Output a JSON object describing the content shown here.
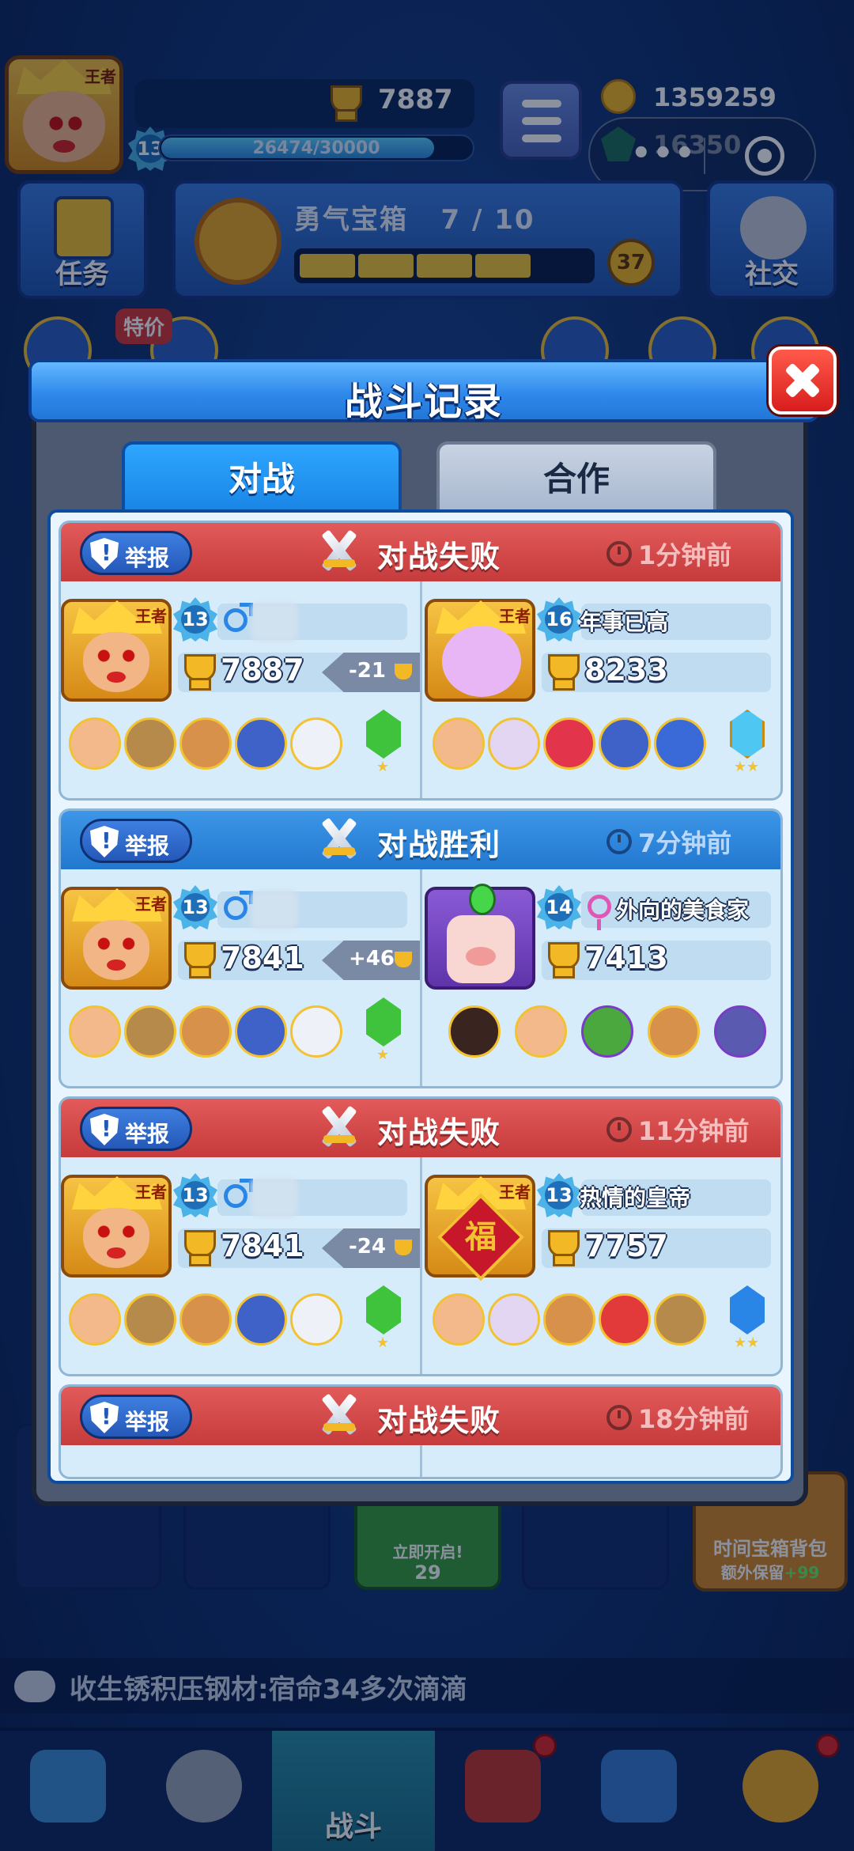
{
  "player": {
    "king_badge": "王者",
    "level": "13",
    "xp_text": "26474/30000",
    "xp_progress": 0.88,
    "trophies": "7887"
  },
  "currency": {
    "coins": "1359259",
    "gems": "16350"
  },
  "menu": {
    "tasks": "任务",
    "social": "社交"
  },
  "chest": {
    "title": "勇气宝箱",
    "progress": "7 / 10",
    "badge": "37"
  },
  "promo": {
    "sale": "特价"
  },
  "modal": {
    "title": "战斗记录",
    "tabs": [
      {
        "label": "对战"
      },
      {
        "label": "合作"
      }
    ]
  },
  "battles": [
    {
      "report": "举报",
      "result": "对战失败",
      "time": "1分钟前",
      "left": {
        "level": "13",
        "trophies": "7887",
        "delta": "-21"
      },
      "right": {
        "level": "16",
        "name": "年事已高",
        "trophies": "8233"
      }
    },
    {
      "report": "举报",
      "result": "对战胜利",
      "time": "7分钟前",
      "left": {
        "level": "13",
        "trophies": "7841",
        "delta": "+46"
      },
      "right": {
        "level": "14",
        "name": "外向的美食家",
        "trophies": "7413"
      }
    },
    {
      "report": "举报",
      "result": "对战失败",
      "time": "11分钟前",
      "left": {
        "level": "13",
        "trophies": "7841",
        "delta": "-24"
      },
      "right": {
        "level": "13",
        "name": "热情的皇帝",
        "trophies": "7757",
        "badge": "福",
        "king_badge": "王者"
      }
    },
    {
      "report": "举报",
      "result": "对战失败",
      "time": "18分钟前"
    }
  ],
  "bottom": {
    "open_now": "立即开启!",
    "open_gems": "29",
    "time_chest": "时间宝箱背包",
    "extra_keep": "额外保留",
    "extra_num": "+99"
  },
  "chat": {
    "message": "收生锈积压钢材:宿命34多次滴滴"
  },
  "nav": {
    "battle": "战斗"
  },
  "colors": {
    "lose": "#c63b3b",
    "win": "#2278cf",
    "accent": "#2a86e6"
  }
}
